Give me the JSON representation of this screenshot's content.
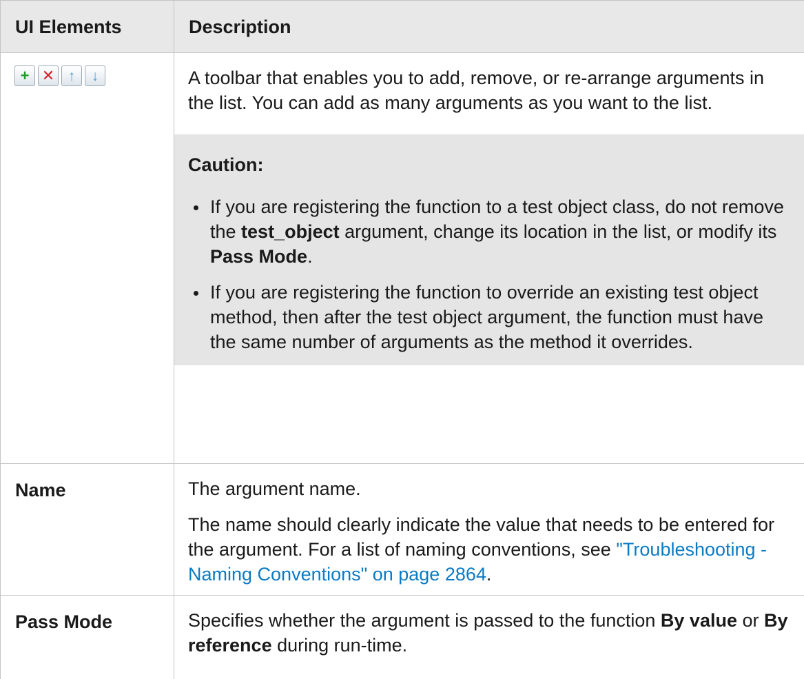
{
  "header": {
    "col1": "UI Elements",
    "col2": "Description"
  },
  "colors": {
    "link": "#0b7bc4",
    "header_bg": "#e8e8e8",
    "caution_bg": "#e5e5e5",
    "add_icon": "#1e9b2a",
    "remove_icon": "#d3202a",
    "arrow_icon": "#4aa3d9"
  },
  "toolbar_row": {
    "icons": [
      "plus-icon",
      "remove-x-icon",
      "arrow-up-icon",
      "arrow-down-icon"
    ],
    "glyphs": {
      "add": "+",
      "remove": "✕",
      "up": "↑",
      "down": "↓"
    },
    "description": "A toolbar that enables you to add, remove, or re-arrange arguments in the list. You can add as many arguments as you want to the list.",
    "caution": {
      "title": "Caution:",
      "bullets": [
        {
          "t1": "If you are registering the function to a test object class, do not remove the ",
          "b1": "test_object",
          "t2": " argument, change its location in the list, or modify its ",
          "b2": "Pass Mode",
          "t3": "."
        },
        {
          "t1": "If you are registering the function to override an existing test object method, then after the test object argument, the function must have the same number of arguments as the method it overrides."
        }
      ]
    }
  },
  "name_row": {
    "label": "Name",
    "p1": "The argument name.",
    "p2": "The name should clearly indicate the value that needs to be entered for the argument. For a list of naming conventions, see ",
    "link": "\"Troubleshooting - Naming Conventions\" on page 2864",
    "p2_end": "."
  },
  "passmode_row": {
    "label": "Pass Mode",
    "t1": "Specifies whether the argument is passed to the function ",
    "b1": "By value",
    "t2": " or ",
    "b2": "By reference",
    "t3": " during run-time."
  }
}
